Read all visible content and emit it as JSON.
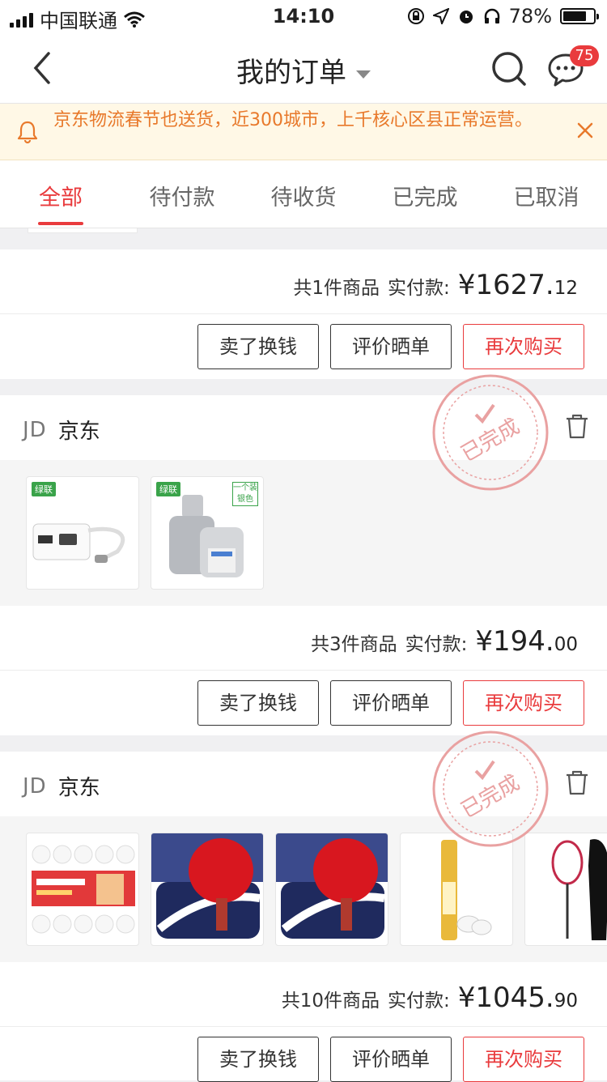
{
  "status": {
    "carrier": "中国联通",
    "time": "14:10",
    "battery": "78%",
    "battery_level": 0.78
  },
  "nav": {
    "title": "我的订单",
    "badge": "75"
  },
  "notice": {
    "text": "京东物流春节也送货，近300城市，上千核心区县正常运营。"
  },
  "tabs": [
    {
      "label": "全部",
      "active": true
    },
    {
      "label": "待付款"
    },
    {
      "label": "待收货"
    },
    {
      "label": "已完成"
    },
    {
      "label": "已取消"
    }
  ],
  "orders": [
    {
      "summary_count": "共1件商品",
      "summary_paid": "实付款:",
      "price_main": "¥1627.",
      "price_decimal": "12",
      "buttons": {
        "sell": "卖了换钱",
        "review": "评价晒单",
        "rebuy": "再次购买"
      }
    },
    {
      "shop_prefix": "JD",
      "shop_name": "京东",
      "stamp": "已完成",
      "items": [
        {
          "tag": "绿联",
          "name": "usb-c-hdmi-adapter"
        },
        {
          "tag": "绿联",
          "extra": "一个装 银色",
          "name": "usb-c-otg-adapter"
        }
      ],
      "summary_count": "共3件商品",
      "summary_paid": "实付款:",
      "price_main": "¥194.",
      "price_decimal": "00",
      "buttons": {
        "sell": "卖了换钱",
        "review": "评价晒单",
        "rebuy": "再次购买"
      }
    },
    {
      "shop_prefix": "JD",
      "shop_name": "京东",
      "stamp": "已完成",
      "items": [
        {
          "name": "ping-pong-balls"
        },
        {
          "name": "table-tennis-paddle"
        },
        {
          "name": "table-tennis-paddle"
        },
        {
          "name": "badminton-shuttlecocks"
        },
        {
          "name": "badminton-racket"
        }
      ],
      "summary_count": "共10件商品",
      "summary_paid": "实付款:",
      "price_main": "¥1045.",
      "price_decimal": "90",
      "buttons": {
        "sell": "卖了换钱",
        "review": "评价晒单",
        "rebuy": "再次购买"
      }
    }
  ],
  "colors": {
    "accent": "#e93b3d",
    "notice_text": "#e8792b",
    "notice_bg": "#fff8e6",
    "stamp": "#e9a1a1"
  }
}
